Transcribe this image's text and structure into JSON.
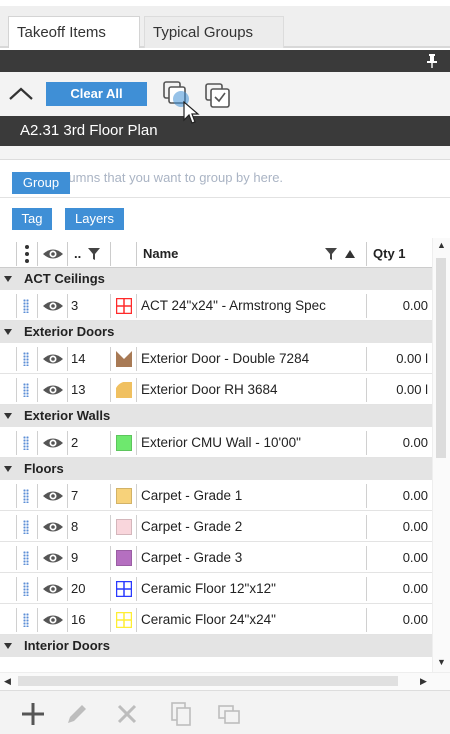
{
  "tabs": [
    {
      "label": "Takeoff Items"
    },
    {
      "label": "Typical Groups"
    }
  ],
  "toolbar": {
    "clear_all": "Clear All"
  },
  "drawing": {
    "title": "A2.31 3rd Floor Plan"
  },
  "grouping": {
    "hint": "Drag columns that you want to group by here.",
    "group_button": "Group",
    "tag_button": "Tag",
    "layers_button": "Layers"
  },
  "columns": {
    "id": "..",
    "name": "Name",
    "qty": "Qty 1"
  },
  "groups": [
    {
      "label": "ACT Ceilings",
      "rows": [
        {
          "id": "3",
          "name": "ACT 24\"x24\" - Armstrong Spec",
          "qty": "0.00",
          "color": "#ff2a2a",
          "icon": "grid-swatch"
        }
      ]
    },
    {
      "label": "Exterior Doors",
      "rows": [
        {
          "id": "14",
          "name": "Exterior Door - Double 7284",
          "qty": "0.00 l",
          "color": "#a87a55",
          "icon": "double-door-swatch"
        },
        {
          "id": "13",
          "name": "Exterior Door RH 3684",
          "qty": "0.00 l",
          "color": "#f0c060",
          "icon": "door-swing-swatch"
        }
      ]
    },
    {
      "label": "Exterior Walls",
      "rows": [
        {
          "id": "2",
          "name": "Exterior CMU Wall - 10'00\"",
          "qty": "0.00",
          "color": "#6ee86e",
          "icon": "solid-swatch"
        }
      ]
    },
    {
      "label": "Floors",
      "rows": [
        {
          "id": "7",
          "name": "Carpet - Grade 1",
          "qty": "0.00",
          "color": "#f7d27a",
          "icon": "solid-swatch"
        },
        {
          "id": "8",
          "name": "Carpet - Grade 2",
          "qty": "0.00",
          "color": "#f9d6dc",
          "icon": "solid-swatch"
        },
        {
          "id": "9",
          "name": "Carpet - Grade 3",
          "qty": "0.00",
          "color": "#b56fc0",
          "icon": "solid-swatch"
        },
        {
          "id": "20",
          "name": "Ceramic Floor 12\"x12\"",
          "qty": "0.00",
          "color": "#2a3aff",
          "icon": "grid-swatch"
        },
        {
          "id": "16",
          "name": "Ceramic Floor 24\"x24\"",
          "qty": "0.00",
          "color": "#ffee33",
          "icon": "grid-swatch"
        }
      ]
    },
    {
      "label": "Interior Doors",
      "rows": []
    }
  ]
}
